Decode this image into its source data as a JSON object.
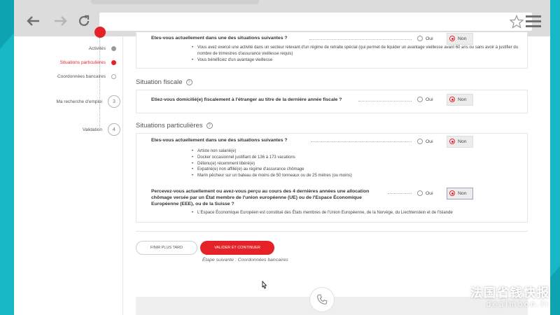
{
  "sidebar": {
    "steps": [
      {
        "label": "Activités",
        "state": "done"
      },
      {
        "label": "Situations particulières",
        "state": "active"
      },
      {
        "label": "Coordonnées bancaires",
        "state": "todo"
      },
      {
        "label": "Ma recherche d'emploi",
        "state": "todo",
        "number": "3"
      },
      {
        "label": "Validation",
        "state": "todo",
        "number": "4"
      }
    ]
  },
  "section1": {
    "question": "Etes-vous actuellement dans une des situations suivantes ?",
    "bullets": [
      "Vous avez exercé une activité dans un secteur relevant d'un régime de retraite spécial (qui permet de liquider un avantage vieillesse avant 60 ans ou sans avoir à justifier du nombre de trimestres d'assurance vieillesse requis)",
      "Vous bénéficiez d'un avantage vieillesse"
    ],
    "selected": "Non"
  },
  "fiscal": {
    "title": "Situation fiscale",
    "question": "Etiez-vous domicilié(e) fiscalement à l'étranger au titre de la dernière année fiscale ?",
    "selected": "Non"
  },
  "particulieres": {
    "title": "Situations particulières",
    "q1": "Etes-vous actuellement dans une des situations suivantes ?",
    "q1_bullets": [
      "Artiste non salarié(e)",
      "Docker occasionnel justifiant de 136 à 173 vacations",
      "Détenu(e) récemment libéré(e)",
      "Expatrié(e) non affilié(e) au régime d'assurance chômage",
      "Marin pêcheur sur un bateau de moins de 50 tonneaux ou de 25 mètres (ou moins)"
    ],
    "q1_selected": "Non",
    "q2_line1": "Percevez-vous actuellement ou avez-vous perçu au cours des 4 dernières années une allocation",
    "q2_line2": "chômage versée par un État membre de l'union européenne (UE) ou de l'Espace Économique",
    "q2_line3": "Européenne (EEE), ou de la Suisse ?",
    "q2_bullets": [
      "L'Espace Économique Européen est constitué des États membres de l'Union Européenne, de la Norvège, du Liechtenstein et de l'Islande"
    ],
    "q2_selected": "Non"
  },
  "options": {
    "oui": "Oui",
    "non": "Non"
  },
  "buttons": {
    "later": "FINIR PLUS TARD",
    "validate": "VALIDER ET CONTINUER"
  },
  "next_step": "Étape suivante : Coordonnées bancaires",
  "watermark": {
    "cn": "法国省钱快报",
    "en": "dealmoon.fr"
  },
  "colors": {
    "accent": "#e52228",
    "frame": "#17b7c5"
  },
  "icons": [
    "back-arrow-icon",
    "forward-arrow-icon",
    "refresh-icon",
    "star-icon",
    "menu-icon",
    "help-icon",
    "phone-icon",
    "cursor-icon"
  ]
}
